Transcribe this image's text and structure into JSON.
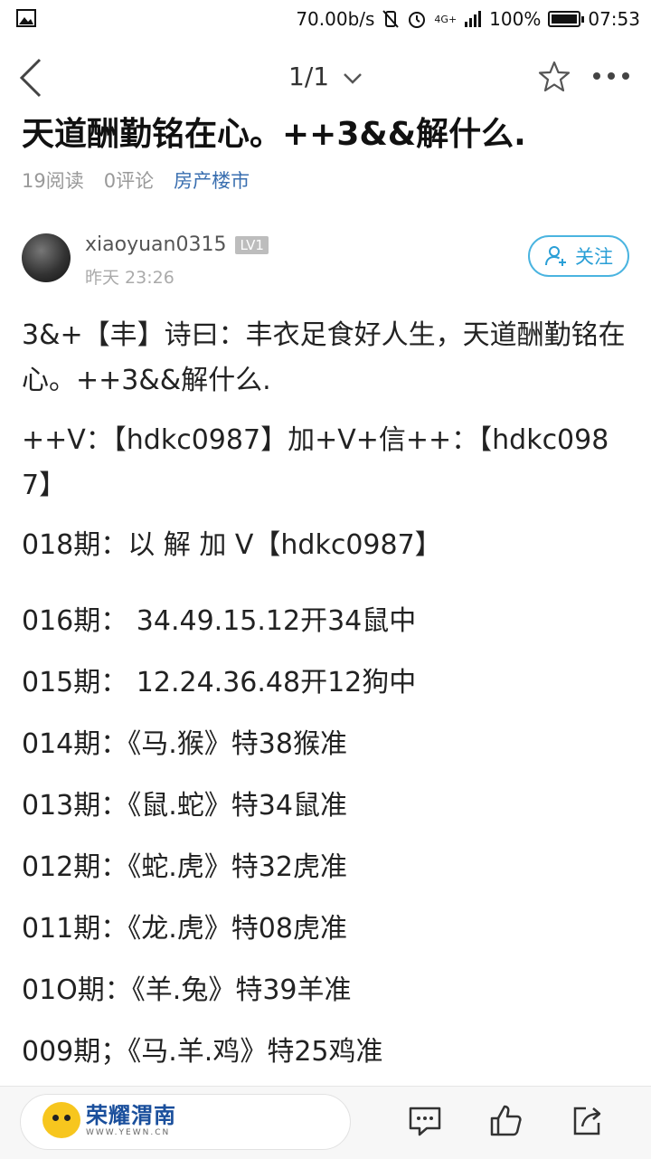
{
  "status_bar": {
    "speed": "70.00b/s",
    "network": "4G+",
    "battery": "100%",
    "time": "07:53"
  },
  "title_bar": {
    "pager": "1/1"
  },
  "article": {
    "headline": "天道酬勤铭在心。++3&&解什么.",
    "reads": "19阅读",
    "comments": "0评论",
    "category": "房产楼市"
  },
  "author": {
    "name": "xiaoyuan0315",
    "level": "LV1",
    "time": "昨天 23:26",
    "follow_label": "关注"
  },
  "body": {
    "p1": "3&+【丰】诗曰：丰衣足食好人生，天道酬勤铭在心。++3&&解什么.",
    "p2": "++V：【hdkc0987】加+V+信++：【hdkc0987】",
    "lines": [
      "018期：以 解 加 V【hdkc0987】",
      "016期： 34.49.15.12开34鼠中",
      "015期： 12.24.36.48开12狗中",
      "014期：《马.猴》特38猴准",
      "013期：《鼠.蛇》特34鼠准",
      "012期：《蛇.虎》特32虎准",
      "011期：《龙.虎》特08虎准",
      "01O期：《羊.兔》特39羊准",
      "009期；《马.羊.鸡》特25鸡准"
    ]
  },
  "bottom_bar": {
    "brand_name": "荣耀渭南",
    "brand_url": "WWW.YEWN.CN"
  },
  "colors": {
    "accent": "#2a9fd6",
    "category": "#3a6fb0",
    "meta_gray": "#999999"
  }
}
